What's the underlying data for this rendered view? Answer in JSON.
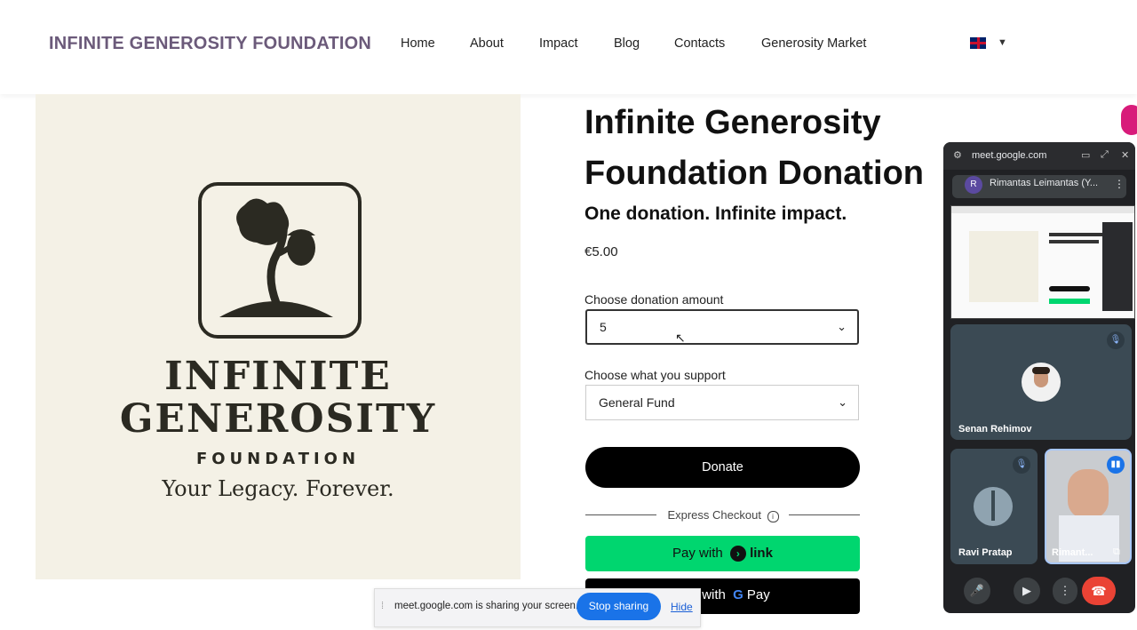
{
  "header": {
    "brand": "INFINITE GENEROSITY FOUNDATION",
    "nav": [
      "Home",
      "About",
      "Impact",
      "Blog",
      "Contacts",
      "Generosity Market"
    ],
    "language_flag": "uk-flag-icon"
  },
  "product": {
    "logo_line1": "INFINITE",
    "logo_line2": "GENEROSITY",
    "logo_line3": "FOUNDATION",
    "logo_tagline": "Your Legacy. Forever.",
    "title": "Infinite Generosity Foundation Donation",
    "subtitle": "One donation. Infinite impact.",
    "price": "€5.00",
    "amount_label": "Choose donation amount",
    "amount_value": "5",
    "support_label": "Choose what you support",
    "support_value": "General Fund",
    "donate_label": "Donate",
    "express_label": "Express Checkout",
    "pay_link_prefix": "Pay with",
    "pay_link_brand": "link",
    "gpay_text": "Buy with",
    "gpay_brand": "Pay"
  },
  "share_bar": {
    "message": "meet.google.com is sharing your screen.",
    "stop_label": "Stop sharing",
    "hide_label": "Hide"
  },
  "meet": {
    "url": "meet.google.com",
    "presenter_initial": "R",
    "presenter_name": "Rimantas Leimantas (Y...",
    "participants": [
      "Senan Rehimov",
      "Ravi Pratap",
      "Rimant..."
    ]
  },
  "colors": {
    "brand": "#6b5a7a",
    "link_green": "#00d66f",
    "meet_blue": "#1a73e8",
    "end_call": "#ea4335"
  }
}
